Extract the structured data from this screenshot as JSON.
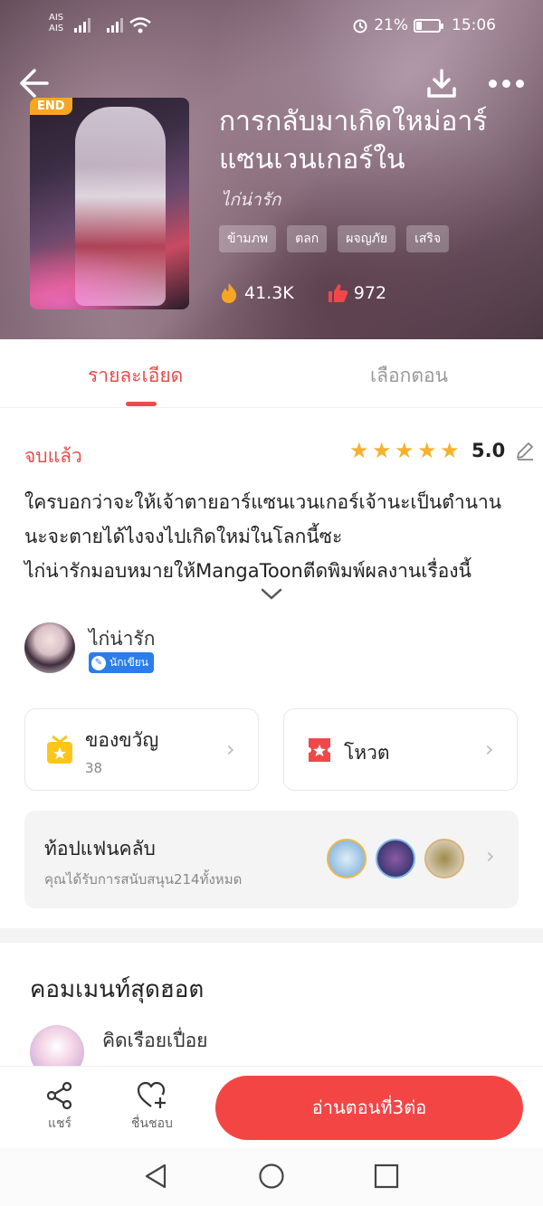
{
  "status_bar": {
    "carrier1": "AIS",
    "carrier2": "AIS",
    "battery": "21%",
    "time": "15:06"
  },
  "hero": {
    "end_badge": "END",
    "title": "การกลับมาเกิดใหม่อาร์แซนเวนเกอร์ใน",
    "author": "ไก่น่ารัก",
    "tags": [
      "ข้ามภพ",
      "ตลก",
      "ผจญภัย",
      "เสริจ"
    ],
    "views": "41.3K",
    "likes": "972"
  },
  "tabs": {
    "details": "รายละเอียด",
    "episodes": "เลือกตอน"
  },
  "details": {
    "status": "จบแล้ว",
    "rating": "5.0",
    "stars": 5,
    "description": [
      "ใครบอกว่าจะให้เจ้าตายอาร์แซนเวนเกอร์เจ้านะเป็นตำนาน",
      "นะจะตายได้ไงจงไปเกิดใหม่ในโลกนี้ซะ",
      "ไก่น่ารักมอบหมายให้MangaToonตีดพิมพ์ผลงานเรื่องนี้"
    ],
    "author_name": "ไก่น่ารัก",
    "author_badge": "นักเขียน"
  },
  "cards": {
    "gift_label": "ของขวัญ",
    "gift_count": "38",
    "vote_label": "โหวต"
  },
  "fanclub": {
    "title": "ท้อปแฟนคลับ",
    "subtitle": "คุณได้รับการสนับสนุน214ทั้งหมด"
  },
  "comments": {
    "title": "คอมเมนท์สุดฮอต",
    "first_user": "คิดเรือยเปื่อย"
  },
  "bottom_bar": {
    "share": "แชร์",
    "favorite": "ชื่นชอบ",
    "read_button": "อ่านตอนที่3ต่อ"
  },
  "colors": {
    "accent": "#e84c4c",
    "star": "#f6b12c",
    "button": "#f44545"
  }
}
